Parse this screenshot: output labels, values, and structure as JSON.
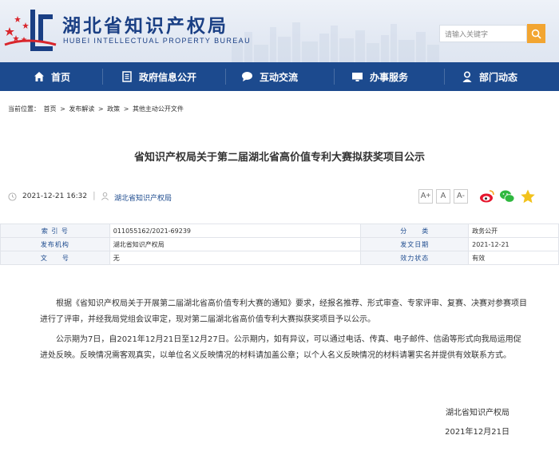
{
  "header": {
    "logo_cn": "湖北省知识产权局",
    "logo_en": "HUBEI INTELLECTUAL PROPERTY BUREAU",
    "search_placeholder": "请输入关键字"
  },
  "nav": {
    "items": [
      {
        "label": "首页",
        "icon": "home-icon"
      },
      {
        "label": "政府信息公开",
        "icon": "document-icon"
      },
      {
        "label": "互动交流",
        "icon": "chat-bubble-icon"
      },
      {
        "label": "办事服务",
        "icon": "monitor-icon"
      },
      {
        "label": "部门动态",
        "icon": "person-icon"
      }
    ]
  },
  "breadcrumb": {
    "prefix": "当前位置：",
    "items": [
      "首页",
      "发布解读",
      "政策",
      "其他主动公开文件"
    ],
    "separator": ">"
  },
  "article": {
    "title": "省知识产权局关于第二届湖北省高价值专利大赛拟获奖项目公示",
    "date": "2021-12-21 16:32",
    "source": "湖北省知识产权局",
    "font_sizes": [
      "A+",
      "A",
      "A-"
    ],
    "share_icons": [
      "weibo-icon",
      "wechat-icon",
      "favorite-icon"
    ],
    "paragraphs": [
      "根据《省知识产权局关于开展第二届湖北省高价值专利大赛的通知》要求，经报名推荐、形式审查、专家评审、复赛、决赛对参赛项目进行了评审，并经我局党组会议审定，现对第二届湖北省高价值专利大赛拟获奖项目予以公示。",
      "公示期为7日，自2021年12月21日至12月27日。公示期内，如有异议，可以通过电话、传真、电子邮件、信函等形式向我局运用促进处反映。反映情况需客观真实，以单位名义反映情况的材料请加盖公章；以个人名义反映情况的材料请署实名并提供有效联系方式。"
    ],
    "signature_org": "湖北省知识产权局",
    "signature_date": "2021年12月21日"
  },
  "info_table": {
    "rows": [
      {
        "l1": "索 引 号",
        "v1": "011055162/2021-69239",
        "l2": "分　　类",
        "v2": "政务公开"
      },
      {
        "l1": "发布机构",
        "v1": "湖北省知识产权局",
        "l2": "发文日期",
        "v2": "2021-12-21"
      },
      {
        "l1": "文　　号",
        "v1": "无",
        "l2": "效力状态",
        "v2": "有效"
      }
    ]
  },
  "colors": {
    "nav_bg": "#1c4a8e",
    "brand_blue": "#1a3f84",
    "search_button": "#f2a531",
    "logo_red": "#d9262c"
  }
}
